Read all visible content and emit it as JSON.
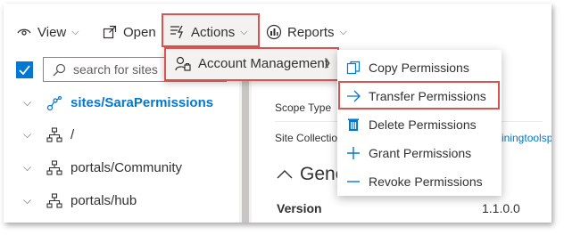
{
  "toolbar": {
    "view_label": "View",
    "open_label": "Open",
    "actions_label": "Actions",
    "reports_label": "Reports"
  },
  "search": {
    "placeholder": "search for sites"
  },
  "tree": {
    "items": [
      {
        "label": "sites/SaraPermissions",
        "selected": true
      },
      {
        "label": "/"
      },
      {
        "label": "portals/Community"
      },
      {
        "label": "portals/hub"
      }
    ]
  },
  "detail": {
    "scope_type_label": "Scope Type",
    "site_collection_label": "Site Collectio",
    "site_collection_link": "iningtoolspro",
    "general_section": "Gene",
    "version_label": "Version",
    "version_value": "1.1.0.0"
  },
  "actions_menu": {
    "account_management_label": "Account Management"
  },
  "submenu": {
    "items": [
      {
        "label": "Copy Permissions",
        "icon": "copy-icon"
      },
      {
        "label": "Transfer Permissions",
        "icon": "arrow-right-icon"
      },
      {
        "label": "Delete Permissions",
        "icon": "trash-icon"
      },
      {
        "label": "Grant Permissions",
        "icon": "plus-icon"
      },
      {
        "label": "Revoke Permissions",
        "icon": "minus-icon"
      }
    ]
  },
  "colors": {
    "accent": "#0078d4",
    "highlight_border": "#d9534f",
    "hover_bg": "#f3f2f1"
  }
}
